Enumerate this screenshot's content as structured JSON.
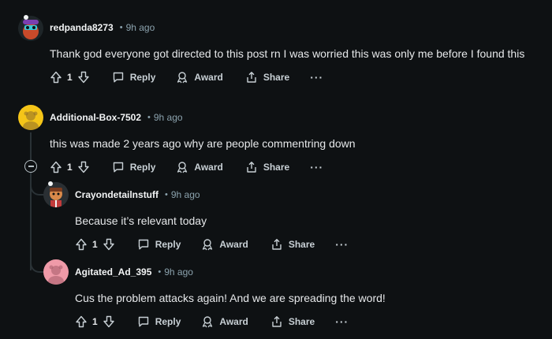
{
  "comments": [
    {
      "username": "redpanda8273",
      "time": "9h ago",
      "body": "Thank god everyone got directed to this post rn I was worried this was only me before I found this",
      "votes": "1",
      "reply": "Reply",
      "award": "Award",
      "share": "Share",
      "more": "···"
    },
    {
      "username": "Additional-Box-7502",
      "time": "9h ago",
      "body": "this was made 2 years ago why are people commentring down",
      "votes": "1",
      "reply": "Reply",
      "award": "Award",
      "share": "Share",
      "more": "···"
    },
    {
      "username": "Crayondetailnstuff",
      "time": "9h ago",
      "body": "Because it’s relevant today",
      "votes": "1",
      "reply": "Reply",
      "award": "Award",
      "share": "Share",
      "more": "···"
    },
    {
      "username": "Agitated_Ad_395",
      "time": "9h ago",
      "body": "Cus the problem attacks again! And we are spreading the word!",
      "votes": "1",
      "reply": "Reply",
      "award": "Award",
      "share": "Share",
      "more": "···"
    }
  ],
  "separator": "•",
  "colors": {
    "background": "#0e1113",
    "meta": "#8ba2ad",
    "thread_line": "#2a3236",
    "avatar_yellow": "#f5c518",
    "avatar_pink": "#ef9aa8"
  }
}
